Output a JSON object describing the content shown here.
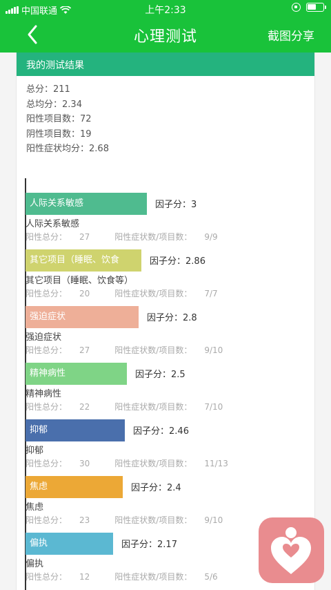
{
  "status_bar": {
    "carrier": "中国联通",
    "time": "上午2:33"
  },
  "nav": {
    "title": "心理测试",
    "share_label": "截图分享"
  },
  "result": {
    "header": "我的测试结果",
    "summary": [
      {
        "label": "总分：",
        "value": "211"
      },
      {
        "label": "总均分：",
        "value": "2.34"
      },
      {
        "label": "阳性项目数：",
        "value": "72"
      },
      {
        "label": "阴性项目数：",
        "value": "19"
      },
      {
        "label": "阳性症状均分：",
        "value": "2.68"
      }
    ]
  },
  "factor_labels": {
    "score": "因子分：",
    "positive_total": "阳性总分：",
    "ratio": "阳性症状数/项目数："
  },
  "factors": [
    {
      "bar_label": "人际关系敏感",
      "name": "人际关系敏感",
      "score": "3",
      "positive_total": "27",
      "ratio": "9/9",
      "color": "#4fbb8f"
    },
    {
      "bar_label": "其它项目（睡眠、饮食",
      "name": "其它项目（睡眠、饮食等）",
      "score": "2.86",
      "positive_total": "20",
      "ratio": "7/7",
      "color": "#cfd36e"
    },
    {
      "bar_label": "强迫症状",
      "name": "强迫症状",
      "score": "2.8",
      "positive_total": "27",
      "ratio": "9/10",
      "color": "#eeaf98"
    },
    {
      "bar_label": "精神病性",
      "name": "精神病性",
      "score": "2.5",
      "positive_total": "22",
      "ratio": "7/10",
      "color": "#7fd486"
    },
    {
      "bar_label": "抑郁",
      "name": "抑郁",
      "score": "2.46",
      "positive_total": "30",
      "ratio": "11/13",
      "color": "#4a6fac"
    },
    {
      "bar_label": "焦虑",
      "name": "焦虑",
      "score": "2.4",
      "positive_total": "23",
      "ratio": "9/10",
      "color": "#eca836"
    },
    {
      "bar_label": "偏执",
      "name": "偏执",
      "score": "2.17",
      "positive_total": "12",
      "ratio": "5/6",
      "color": "#5bb8d2"
    }
  ],
  "icons": {
    "back": "chevron-left-icon",
    "float": "heart-person-icon",
    "wifi": "wifi-icon",
    "battery": "battery-icon"
  }
}
